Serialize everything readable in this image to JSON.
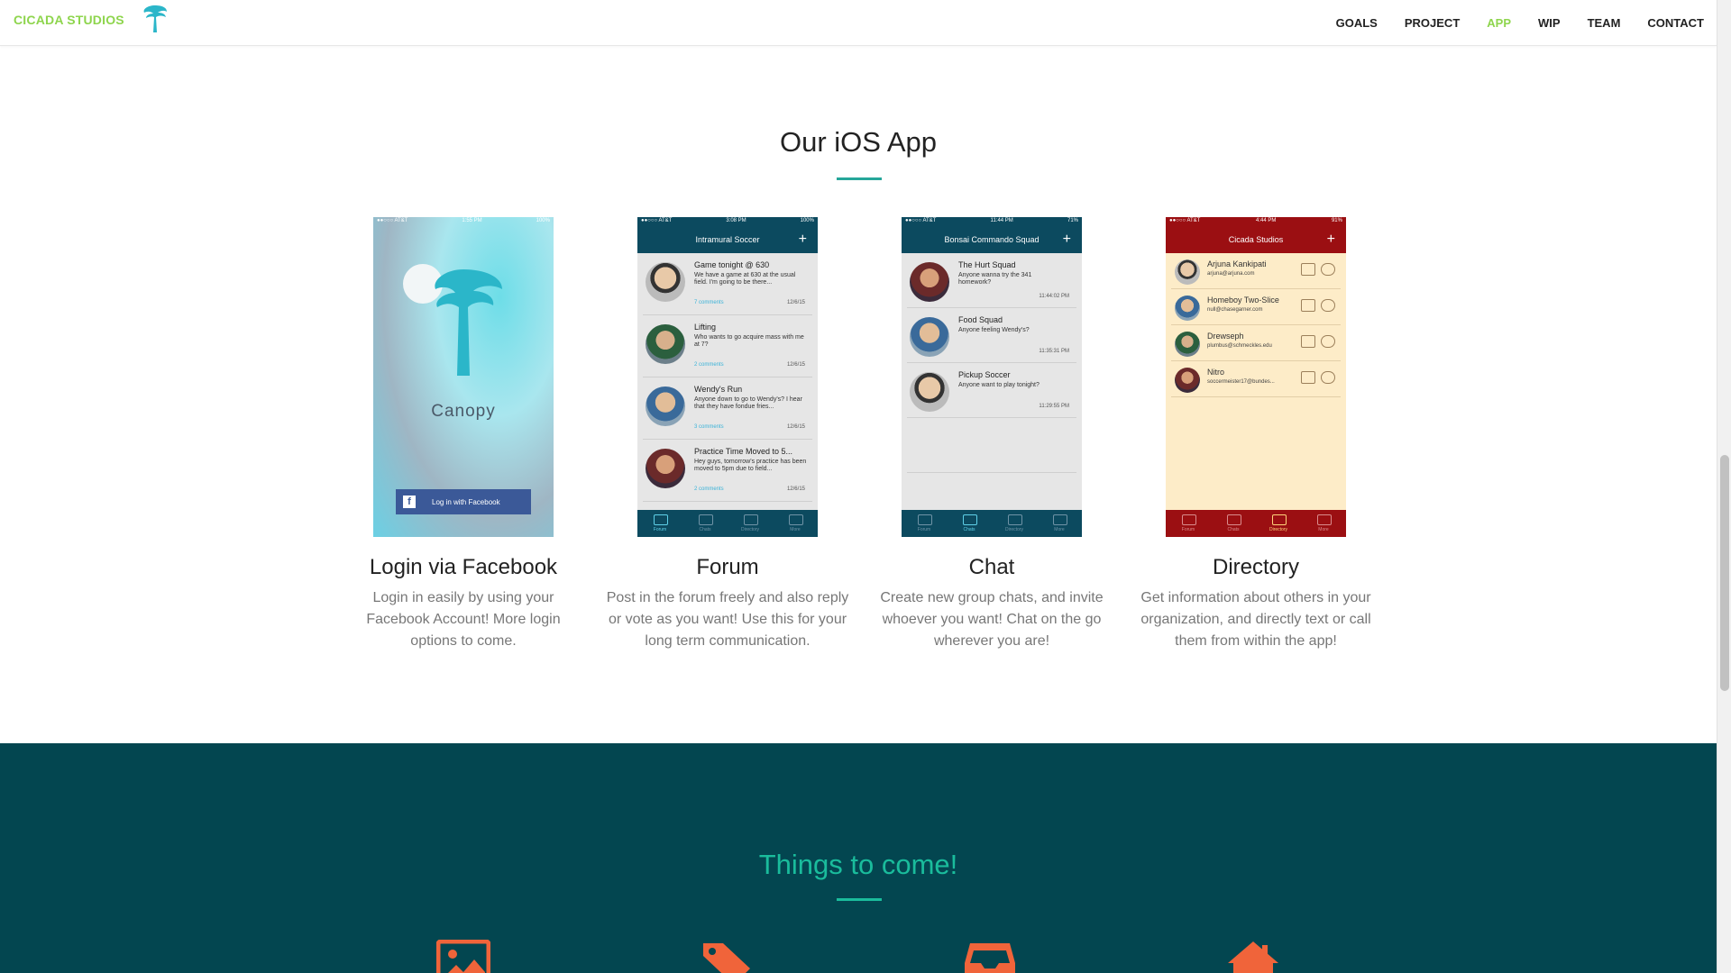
{
  "nav": {
    "brand": "CICADA STUDIOS",
    "items": [
      {
        "label": "GOALS",
        "active": false
      },
      {
        "label": "PROJECT",
        "active": false
      },
      {
        "label": "APP",
        "active": true
      },
      {
        "label": "WIP",
        "active": false
      },
      {
        "label": "TEAM",
        "active": false
      },
      {
        "label": "CONTACT",
        "active": false
      }
    ]
  },
  "app_section": {
    "title": "Our iOS App",
    "cards": [
      {
        "heading": "Login via Facebook",
        "text": "Login in easily by using your Facebook Account! More login options to come.",
        "phone": {
          "status_carrier": "●●○○○ AT&T",
          "status_time": "1:55 PM",
          "status_battery": "100%",
          "app_name": "Canopy",
          "button": "Log in with Facebook"
        }
      },
      {
        "heading": "Forum",
        "text": "Post in the forum freely and also reply or vote as you want! Use this for your long term communication.",
        "phone": {
          "status_carrier": "●●○○○ AT&T",
          "status_time": "3:08 PM",
          "status_battery": "100%",
          "title": "Intramural Soccer",
          "posts": [
            {
              "title": "Game tonight @ 630",
              "body": "We have a game at 630 at the usual field. I'm going to be there...",
              "comments": "7 comments",
              "date": "12/6/15"
            },
            {
              "title": "Lifting",
              "body": "Who wants to go acquire mass with me at 7?",
              "comments": "2 comments",
              "date": "12/6/15"
            },
            {
              "title": "Wendy's Run",
              "body": "Anyone down to go to Wendy's? I hear that they have fondue fries...",
              "comments": "3 comments",
              "date": "12/6/15"
            },
            {
              "title": "Practice Time Moved to 5...",
              "body": "Hey guys, tomorrow's practice has been moved to 5pm due to field...",
              "comments": "2 comments",
              "date": "12/6/15"
            }
          ],
          "tabs": [
            "Forum",
            "Chats",
            "Directory",
            "More"
          ]
        }
      },
      {
        "heading": "Chat",
        "text": "Create new group chats, and invite whoever you want! Chat on the go wherever you are!",
        "phone": {
          "status_carrier": "●●○○○ AT&T",
          "status_time": "11:44 PM",
          "status_battery": "71%",
          "title": "Bonsai Commando Squad",
          "chats": [
            {
              "title": "The Hurt Squad",
              "body": "Anyone wanna try the 341 homework?",
              "time": "11:44:02 PM"
            },
            {
              "title": "Food Squad",
              "body": "Anyone feeling Wendy's?",
              "time": "11:35:31 PM"
            },
            {
              "title": "Pickup Soccer",
              "body": "Anyone want to play tonight?",
              "time": "11:29:55 PM"
            }
          ],
          "tabs": [
            "Forum",
            "Chats",
            "Directory",
            "More"
          ]
        }
      },
      {
        "heading": "Directory",
        "text": "Get information about others in your organization, and directly text or call them from within the app!",
        "phone": {
          "status_carrier": "●●○○○ AT&T",
          "status_time": "4:44 PM",
          "status_battery": "91%",
          "title": "Cicada Studios",
          "people": [
            {
              "name": "Arjuna Kankipati",
              "email": "arjuna@arjuna.com"
            },
            {
              "name": "Homeboy Two-Slice",
              "email": "null@chasegarner.com"
            },
            {
              "name": "Drewseph",
              "email": "plumbus@schmeckles.edu"
            },
            {
              "name": "Nitro",
              "email": "soccermeister17@bundes..."
            }
          ],
          "tabs": [
            "Forum",
            "Chats",
            "Directory",
            "More"
          ]
        }
      }
    ]
  },
  "coming_section": {
    "title": "Things to come!",
    "icons": [
      "image-icon",
      "tag-icon",
      "inbox-icon",
      "home-icon"
    ]
  },
  "colors": {
    "brand_green": "#8ed54d",
    "accent_teal": "#26a69a",
    "dark_bg": "#034650",
    "icon_orange": "#f0643a",
    "forum_bar": "#0c4a5f",
    "directory_bar": "#9b0f12"
  }
}
